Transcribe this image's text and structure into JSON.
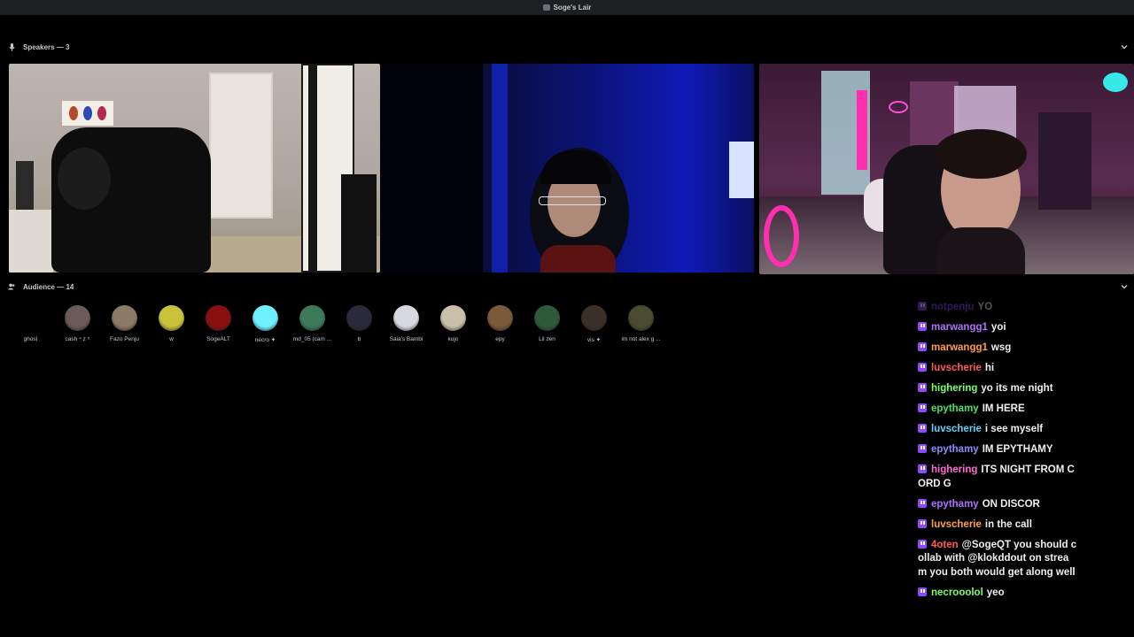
{
  "window": {
    "title": "Soge's Lair"
  },
  "speakers": {
    "header": "Speakers — 3"
  },
  "audience": {
    "header": "Audience — 14",
    "members": [
      {
        "name": "ghost",
        "color": "#000000"
      },
      {
        "name": "cash ⁴ z ⁵",
        "color": "#6b5a55"
      },
      {
        "name": "Fazo Penju",
        "color": "#8a7a66"
      },
      {
        "name": "w",
        "color": "#c9c23a"
      },
      {
        "name": "SogeALT",
        "color": "#8a1010"
      },
      {
        "name": "necro ✦",
        "color": "#6ff0ff"
      },
      {
        "name": "md_05 (cam ...",
        "color": "#3d7a5c"
      },
      {
        "name": "b",
        "color": "#2a2a3a"
      },
      {
        "name": "Saia's Bambi",
        "color": "#d8d8e0"
      },
      {
        "name": "kujo",
        "color": "#c8c0a8"
      },
      {
        "name": "epy",
        "color": "#7a5a3a"
      },
      {
        "name": "Lil zen",
        "color": "#2f5a3a"
      },
      {
        "name": "vis ✦",
        "color": "#3a3028"
      },
      {
        "name": "im not alex g ...",
        "color": "#4a4a30"
      }
    ]
  },
  "chat": {
    "messages": [
      {
        "user": "notpenju",
        "color": "#9146ff",
        "text": "YO"
      },
      {
        "user": "marwangg1",
        "color": "#b06fff",
        "text": "yoi"
      },
      {
        "user": "marwangg1",
        "color": "#ff9f45",
        "text": "wsg"
      },
      {
        "user": "luvscherie",
        "color": "#ff5b5b",
        "text": "hi"
      },
      {
        "user": "highering",
        "color": "#7cff6b",
        "text": "yo its me night"
      },
      {
        "user": "epythamy",
        "color": "#4fe06a",
        "text": "IM HERE"
      },
      {
        "user": "luvscherie",
        "color": "#5bd3ff",
        "text": "i see myself"
      },
      {
        "user": "epythamy",
        "color": "#8a8aff",
        "text": "IM EPYTHAMY"
      },
      {
        "user": "highering",
        "color": "#ff6bd3",
        "text": "ITS NIGHT FROM CORD G"
      },
      {
        "user": "epythamy",
        "color": "#b06fff",
        "text": "ON DISCOR"
      },
      {
        "user": "luvscherie",
        "color": "#ff9f45",
        "text": "in the call"
      },
      {
        "user": "4oten",
        "color": "#ff5b5b",
        "text": "@SogeQT you should collab with @klokddout on stream you both would get along well"
      },
      {
        "user": "necrooolol",
        "color": "#7cff6b",
        "text": "yeo"
      }
    ]
  }
}
